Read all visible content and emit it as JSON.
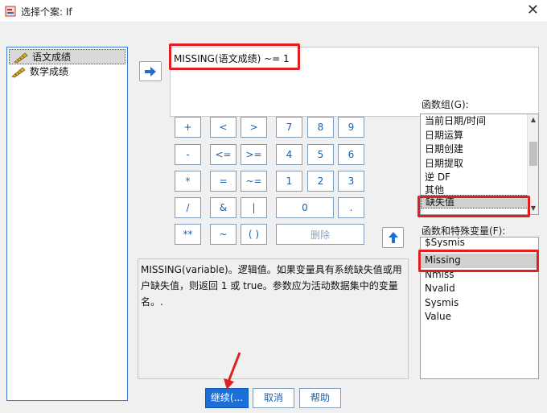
{
  "window": {
    "title": "选择个案: If",
    "close_glyph": "✕"
  },
  "variables": [
    {
      "name": "语文成绩",
      "selected": true
    },
    {
      "name": "数学成绩",
      "selected": false
    }
  ],
  "expression": "MISSING(语文成绩) ~= 1",
  "keypad": {
    "plus": "+",
    "lt": "<",
    "gt": ">",
    "k7": "7",
    "k8": "8",
    "k9": "9",
    "minus": "-",
    "le": "<=",
    "ge": ">=",
    "k4": "4",
    "k5": "5",
    "k6": "6",
    "times": "*",
    "eq": "=",
    "ne": "~=",
    "k1": "1",
    "k2": "2",
    "k3": "3",
    "divide": "/",
    "and": "&",
    "or": "|",
    "k0": "0",
    "dot": ".",
    "power": "**",
    "not": "~",
    "parens": "( )",
    "delete": "删除"
  },
  "description": "MISSING(variable)。逻辑值。如果变量具有系统缺失值或用户缺失值，则返回 1 或 true。参数应为活动数据集中的变量名。.",
  "function_group": {
    "label": "函数组(G):",
    "items": [
      "当前日期/时间",
      "日期运算",
      "日期创建",
      "日期提取",
      "逆 DF",
      "其他",
      "缺失值"
    ],
    "selected": "缺失值"
  },
  "functions": {
    "label": "函数和特殊变量(F):",
    "items": [
      "$Sysmis",
      "Missing",
      "Nmiss",
      "Nvalid",
      "Sysmis",
      "Value"
    ],
    "selected": "Missing"
  },
  "buttons": {
    "continue": "继续(...",
    "cancel": "取消",
    "help": "帮助"
  },
  "colors": {
    "accent": "#1d6fd8",
    "highlight": "#e02020",
    "key_text": "#1f5fa8"
  }
}
